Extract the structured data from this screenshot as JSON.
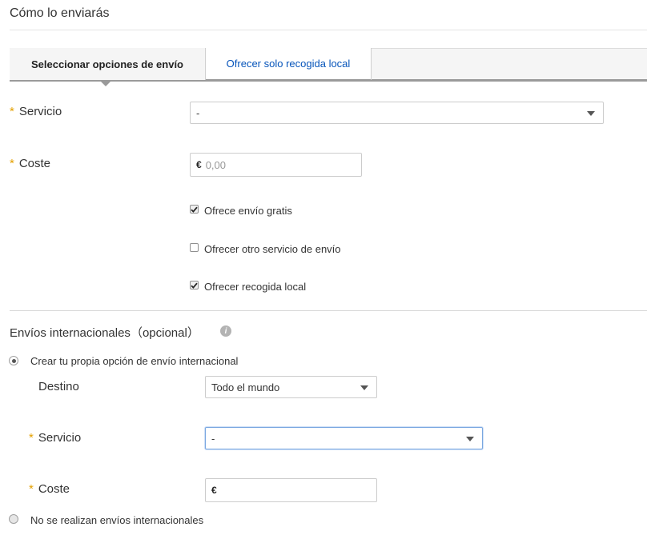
{
  "header": {
    "title": "Cómo lo enviarás"
  },
  "tabs": [
    {
      "label": "Seleccionar opciones de envío"
    },
    {
      "label": "Ofrecer solo recogida local"
    }
  ],
  "domestic": {
    "required_mark": "*",
    "service_label": "Servicio",
    "service_value": "-",
    "cost_label": "Coste",
    "cost_currency": "€",
    "cost_placeholder": "0,00",
    "options": [
      {
        "label": "Ofrece envío gratis",
        "checked": true
      },
      {
        "label": "Ofrecer otro servicio de envío",
        "checked": false
      },
      {
        "label": "Ofrecer recogida local",
        "checked": true
      }
    ]
  },
  "international": {
    "title": "Envíos internacionales",
    "optional": "（opcional）",
    "info_glyph": "i",
    "radio_own_label": "Crear tu propia opción de envío internacional",
    "destination_label": "Destino",
    "destination_value": "Todo el mundo",
    "service_label": "Servicio",
    "service_value": "-",
    "cost_label": "Coste",
    "cost_currency": "€",
    "radio_none_label": "No se realizan envíos internacionales"
  },
  "colors": {
    "link": "#0654ba",
    "required": "#e4a000",
    "focus": "#7aa7e0"
  }
}
